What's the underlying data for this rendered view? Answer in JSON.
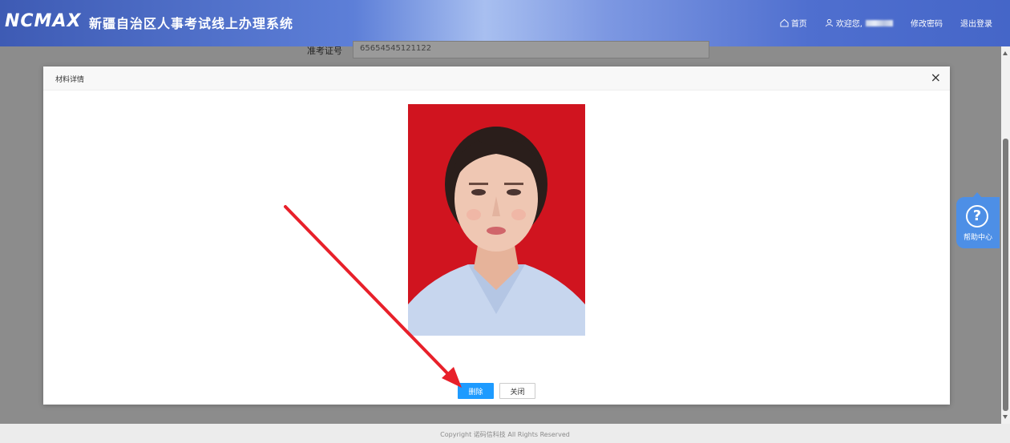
{
  "header": {
    "logo": "NCMAX",
    "title": "新疆自治区人事考试线上办理系统",
    "nav": {
      "home": "首页",
      "welcome": "欢迎您,",
      "change_password": "修改密码",
      "logout": "退出登录"
    }
  },
  "background_form": {
    "label": "准考证号",
    "value": "65654545121122"
  },
  "dialog": {
    "title": "材料详情",
    "close_symbol": "×",
    "delete_button": "删除",
    "close_button": "关闭"
  },
  "help": {
    "icon": "?",
    "label": "帮助中心"
  },
  "footer": {
    "copyright": "Copyright 诺码信科技 All Rights Reserved"
  },
  "colors": {
    "header_blue": "#4566c8",
    "primary_button": "#1e9bff",
    "photo_background": "#d0141f",
    "annotation_arrow": "#e8202a"
  }
}
